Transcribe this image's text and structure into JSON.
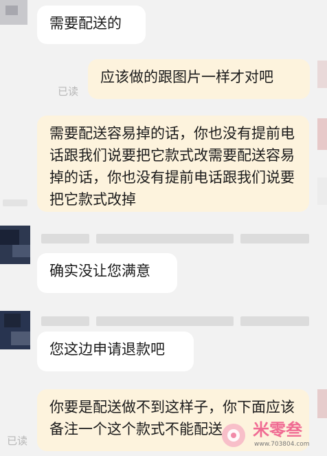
{
  "messages": [
    {
      "text": "需要配送的"
    },
    {
      "text": "应该做的跟图片一样才对吧"
    },
    {
      "text": "需要配送容易掉的话，你也没有提前电话跟我们说要把它款式改需要配送容易掉的话，你也没有提前电话跟我们说要把它款式改掉"
    },
    {
      "text": "确实没让您满意"
    },
    {
      "text": "您这边申请退款吧"
    },
    {
      "text": "你要是配送做不到这样子，你下面应该备注一个这个款式不能配送"
    }
  ],
  "read_label": "已读",
  "watermark": {
    "brand": "米零叁",
    "site": "www.703804.com"
  },
  "colors": {
    "background": "#f2f2f2",
    "incoming": "#ffffff",
    "outgoing": "#fdf3dd"
  }
}
